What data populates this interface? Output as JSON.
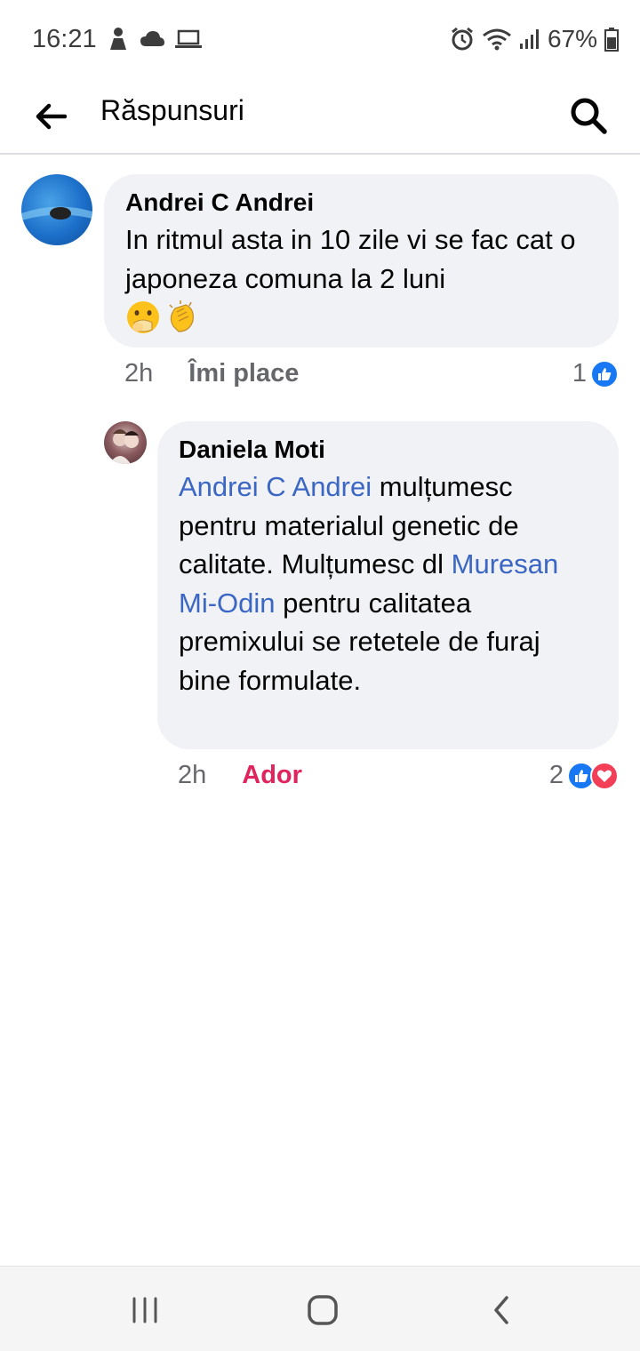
{
  "status_bar": {
    "time": "16:21",
    "battery": "67%"
  },
  "app_bar": {
    "title": "Răspunsuri"
  },
  "comments": [
    {
      "author": "Andrei C Andrei",
      "text": "In  ritmul asta in 10 zile vi se fac cat o japoneza comuna la 2 luni",
      "emojis": [
        "face-with-hand-over-mouth-icon",
        "clapping-hands-icon"
      ],
      "time": "2h",
      "reaction_label": "Îmi place",
      "reaction_count": "1"
    },
    {
      "author": "Daniela Moti",
      "text_parts": [
        {
          "mention": true,
          "text": "Andrei C Andrei"
        },
        {
          "mention": false,
          "text": " mulțumesc pentru materialul genetic de calitate. Mulțumesc dl "
        },
        {
          "mention": true,
          "text": "Muresan Mi-Odin"
        },
        {
          "mention": false,
          "text": " pentru calitatea premixului se retetele de furaj bine formulate."
        }
      ],
      "time": "2h",
      "reaction_label": "Ador",
      "reaction_count": "2"
    }
  ],
  "colors": {
    "mention": "#3b66c4",
    "love": "#e0245e",
    "like": "#1877f2",
    "bubble": "#f0f2f5"
  }
}
